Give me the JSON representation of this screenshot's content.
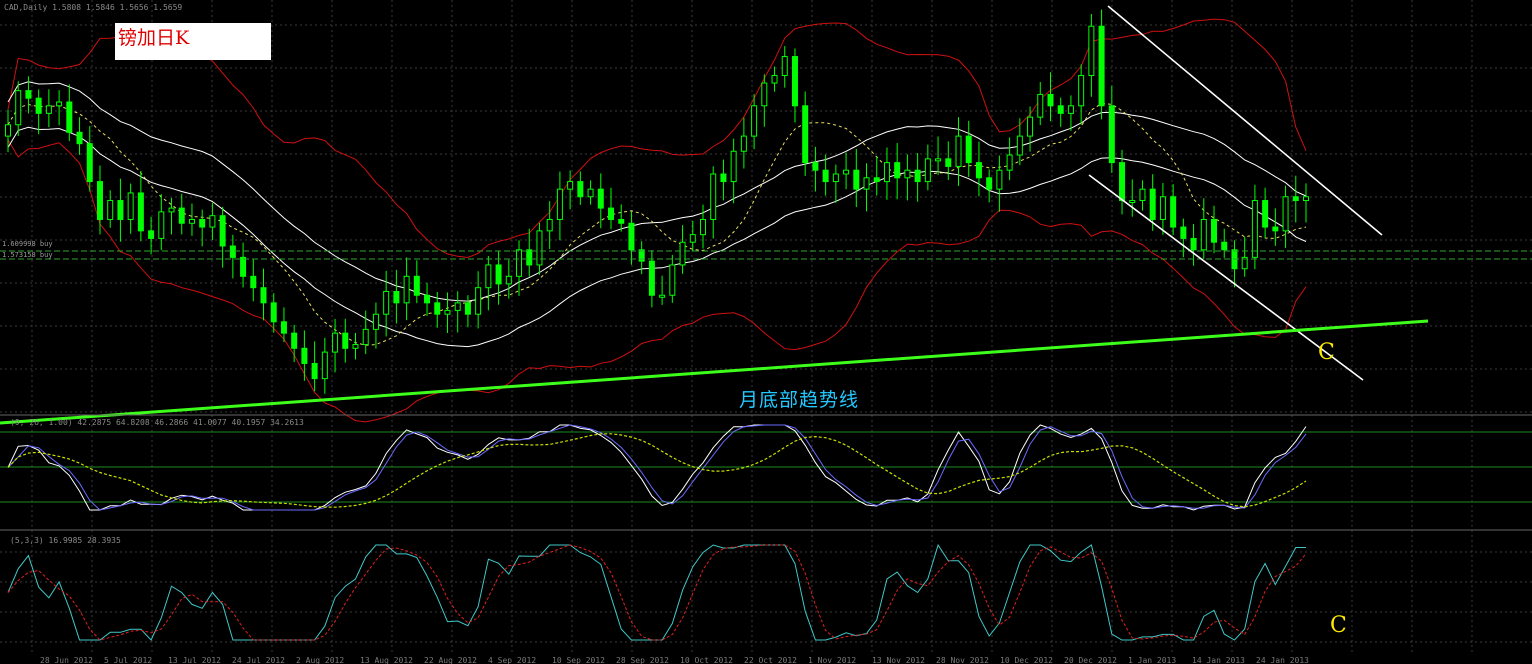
{
  "title_bar": "CAD,Daily  1.5808 1.5846 1.5656 1.5659",
  "chart_label": "镑加日K",
  "trendline_label": "月底部趋势线",
  "wave_label_main": "C",
  "wave_label_stoch": "C",
  "price_tags": [
    "1.609998 buy",
    "1.573158 buy"
  ],
  "indicator1_header": "(9, 26, 1.00) 42.2875 64.8208 46.2866 41.0077 40.1957 34.2613",
  "indicator2_header": "(5,3,3) 16.9985 28.3935",
  "x_axis_labels": [
    "28 Jun 2012",
    "5 Jul 2012",
    "13 Jul 2012",
    "24 Jul 2012",
    "2 Aug 2012",
    "13 Aug 2012",
    "22 Aug 2012",
    "4 Sep 2012",
    "10 Sep 2012",
    "28 Sep 2012",
    "10 Oct 2012",
    "22 Oct 2012",
    "1 Nov 2012",
    "13 Nov 2012",
    "28 Nov 2012",
    "10 Dec 2012",
    "20 Dec 2012",
    "1 Jan 2013",
    "14 Jan 2013",
    "24 Jan 2013"
  ],
  "colors": {
    "background": "#000000",
    "grid": "#3a3a3a",
    "candle": "#00ff00",
    "bollinger": "#d01010",
    "moving_average": "#ffffff",
    "trendline": "#3cff1a",
    "channel": "#ffffff",
    "label_text": "#e00000",
    "wave_label": "#ffea00",
    "trend_label": "#22c8ff"
  },
  "chart_data": {
    "type": "candlestick",
    "title": "镑加日K",
    "closes": [
      1.585,
      1.594,
      1.592,
      1.588,
      1.59,
      1.591,
      1.583,
      1.58,
      1.57,
      1.56,
      1.565,
      1.56,
      1.567,
      1.557,
      1.555,
      1.562,
      1.563,
      1.559,
      1.56,
      1.558,
      1.561,
      1.553,
      1.55,
      1.545,
      1.542,
      1.538,
      1.533,
      1.53,
      1.526,
      1.522,
      1.518,
      1.525,
      1.53,
      1.526,
      1.527,
      1.531,
      1.535,
      1.541,
      1.538,
      1.545,
      1.54,
      1.538,
      1.535,
      1.536,
      1.538,
      1.535,
      1.542,
      1.548,
      1.543,
      1.545,
      1.552,
      1.548,
      1.557,
      1.56,
      1.568,
      1.57,
      1.566,
      1.568,
      1.563,
      1.56,
      1.559,
      1.552,
      1.549,
      1.54,
      1.54,
      1.548,
      1.554,
      1.556,
      1.56,
      1.572,
      1.57,
      1.578,
      1.582,
      1.59,
      1.596,
      1.598,
      1.603,
      1.59,
      1.575,
      1.573,
      1.57,
      1.572,
      1.573,
      1.568,
      1.571,
      1.57,
      1.575,
      1.571,
      1.573,
      1.57,
      1.576,
      1.576,
      1.574,
      1.582,
      1.575,
      1.571,
      1.568,
      1.573,
      1.577,
      1.582,
      1.587,
      1.593,
      1.59,
      1.588,
      1.59,
      1.598,
      1.611,
      1.59,
      1.575,
      1.565,
      1.565,
      1.568,
      1.56,
      1.566,
      1.558,
      1.555,
      1.552,
      1.56,
      1.554,
      1.552,
      1.547,
      1.55,
      1.565,
      1.558,
      1.557,
      1.566,
      1.565,
      1.566
    ]
  }
}
